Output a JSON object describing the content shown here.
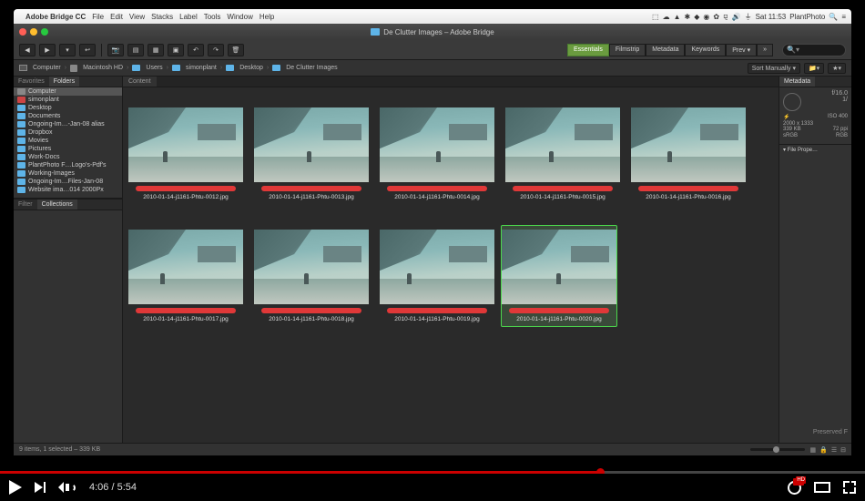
{
  "menubar": {
    "app_name": "Adobe Bridge CC",
    "items": [
      "File",
      "Edit",
      "View",
      "Stacks",
      "Label",
      "Tools",
      "Window",
      "Help"
    ],
    "clock": "Sat 11:53",
    "user": "PlantPhoto"
  },
  "window": {
    "title": "De Clutter Images – Adobe Bridge",
    "folder_title": "De Clutter Images"
  },
  "workspaces": {
    "items": [
      "Essentials",
      "Filmstrip",
      "Metadata",
      "Keywords",
      "Prev"
    ],
    "active": 0
  },
  "breadcrumb": {
    "items": [
      "Computer",
      "Macintosh HD",
      "Users",
      "simonplant",
      "Desktop",
      "De Clutter Images"
    ],
    "sort": "Sort Manually"
  },
  "sidebar": {
    "tabs": [
      "Favorites",
      "Folders"
    ],
    "active_tab": 1,
    "items": [
      {
        "label": "Computer",
        "icon": "gray"
      },
      {
        "label": "simonplant",
        "icon": "red"
      },
      {
        "label": "Desktop",
        "icon": "blue"
      },
      {
        "label": "Documents",
        "icon": "blue"
      },
      {
        "label": "Ongoing-Im…-Jan-08 alias",
        "icon": "blue"
      },
      {
        "label": "Dropbox",
        "icon": "blue"
      },
      {
        "label": "Movies",
        "icon": "blue"
      },
      {
        "label": "Pictures",
        "icon": "blue"
      },
      {
        "label": "Work-Docs",
        "icon": "blue"
      },
      {
        "label": "PlantPhoto F…Logo's-Pdf's",
        "icon": "blue"
      },
      {
        "label": "Working-Images",
        "icon": "blue"
      },
      {
        "label": "Ongoing-Im…Files-Jan-08",
        "icon": "blue"
      },
      {
        "label": "Website ima…014 2000Px",
        "icon": "blue"
      }
    ],
    "lower_tabs": [
      "Filter",
      "Collections"
    ]
  },
  "content": {
    "tab": "Content",
    "thumbs": [
      {
        "file": "2010-01-14-j1161-Phtu-0012.jpg",
        "fig": 38
      },
      {
        "file": "2010-01-14-j1161-Phtu-0013.jpg",
        "fig": 58
      },
      {
        "file": "2010-01-14-j1161-Phtu-0014.jpg",
        "fig": 62
      },
      {
        "file": "2010-01-14-j1161-Phtu-0015.jpg",
        "fig": 48
      },
      {
        "file": "2010-01-14-j1161-Phtu-0016.jpg",
        "fig": 40
      },
      {
        "file": "2010-01-14-j1161-Phtu-0017.jpg",
        "fig": 35
      },
      {
        "file": "2010-01-14-j1161-Phtu-0018.jpg",
        "fig": 55
      },
      {
        "file": "2010-01-14-j1161-Phtu-0019.jpg",
        "fig": 30
      },
      {
        "file": "2010-01-14-j1161-Phtu-0020.jpg",
        "fig": 60,
        "selected": true
      }
    ]
  },
  "metadata": {
    "tab": "Metadata",
    "aperture": "f/16.0",
    "shutter_prefix": "1/",
    "iso": "ISO 400",
    "dimensions": "2000 x 1333",
    "filesize": "339 KB",
    "ppi": "72 ppi",
    "colorspace": "sRGB",
    "rgb": "RGB",
    "section": "File Prope…",
    "preserved": "Preserved F"
  },
  "status": {
    "text": "9 items, 1 selected – 339 KB"
  },
  "youtube": {
    "current": "4:06",
    "duration": "5:54",
    "hd": "HD"
  }
}
